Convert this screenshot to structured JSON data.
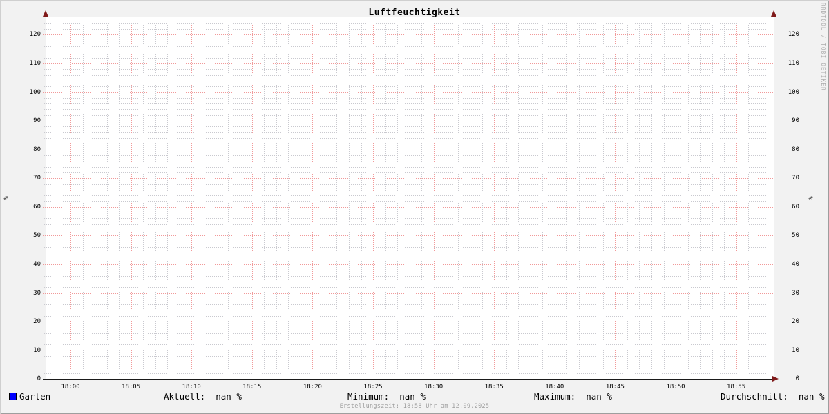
{
  "title": "Luftfeuchtigkeit",
  "watermark": "RRDTOOL / TOBI OETIKER",
  "footer": "Erstellungszeit: 18:58 Uhr am 12.09.2025",
  "legend": {
    "series": [
      {
        "label": "Garten",
        "color": "#0000ff"
      }
    ],
    "stats": [
      {
        "name": "aktuell",
        "text": "Aktuell: -nan %"
      },
      {
        "name": "minimum",
        "text": "Minimum: -nan %"
      },
      {
        "name": "maximum",
        "text": "Maximum: -nan %"
      },
      {
        "name": "durchschnitt",
        "text": "Durchschnitt: -nan %"
      }
    ]
  },
  "chart_data": {
    "type": "line",
    "title": "Luftfeuchtigkeit",
    "xlabel": "",
    "ylabel": "%",
    "x_ticks": [
      "18:00",
      "18:05",
      "18:10",
      "18:15",
      "18:20",
      "18:25",
      "18:30",
      "18:35",
      "18:40",
      "18:45",
      "18:50",
      "18:55"
    ],
    "x_range": [
      "17:58",
      "18:58"
    ],
    "y_ticks": [
      0,
      10,
      20,
      30,
      40,
      50,
      60,
      70,
      80,
      90,
      100,
      110,
      120
    ],
    "ylim": [
      0,
      125
    ],
    "grid": {
      "y_major": 10,
      "y_minor": 2,
      "x_major_minutes": 5,
      "x_minor_minutes": 1
    },
    "series": [
      {
        "name": "Garten",
        "color": "#0000ff",
        "values": []
      }
    ],
    "legend_position": "bottom"
  },
  "colors": {
    "background": "#f2f2f2",
    "plot_background": "#ffffff",
    "grid_major": "#f19999",
    "grid_minor": "#c9c9cf",
    "axis": "#1a1a1a",
    "arrow": "#801a1a",
    "text": "#000000",
    "muted": "#9e9e9e",
    "muted_light": "#ababab"
  }
}
